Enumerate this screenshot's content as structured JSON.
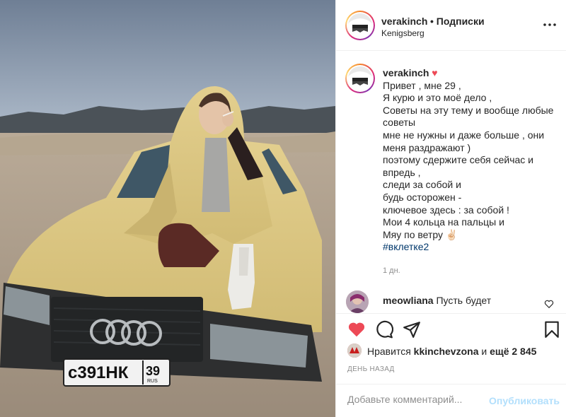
{
  "post": {
    "username": "verakinch",
    "follow_text": "• Подписки",
    "location": "Kenigsberg"
  },
  "photo": {
    "plate": "с391НК",
    "plate_region": "39",
    "plate_country": "RUS"
  },
  "caption": {
    "author": "verakinch",
    "lines": [
      "Привет , мне 29 ,",
      "Я курю и это моё дело ,",
      "Советы на эту тему и вообще любые советы",
      "мне не нужны и даже больше , они меня раздражают )",
      "поэтому сдержите себя сейчас и впредь ,",
      "следи за собой и",
      "будь осторожен -",
      "ключевое здесь : за собой !",
      "Мои 4 кольца на пальцы и",
      "Мяу по ветру ✌🏻"
    ],
    "hashtag": "#вклетке2",
    "time": "1 дн."
  },
  "comment": {
    "author": "meowliana",
    "text": "Пусть будет"
  },
  "likes": {
    "prefix": "Нравится",
    "user": "kkinchevzona",
    "middle": "и",
    "others": "ещё 2 845"
  },
  "post_time": "ДЕНЬ НАЗАД",
  "add_comment": {
    "placeholder": "Добавьте комментарий...",
    "publish": "Опубликовать"
  },
  "colors": {
    "like_red": "#ed4956",
    "link": "#00376b",
    "publish_disabled": "#b2dffc"
  },
  "icons": [
    "more-icon",
    "heart-icon",
    "comment-icon",
    "share-icon",
    "bookmark-icon",
    "heart-small-icon"
  ]
}
